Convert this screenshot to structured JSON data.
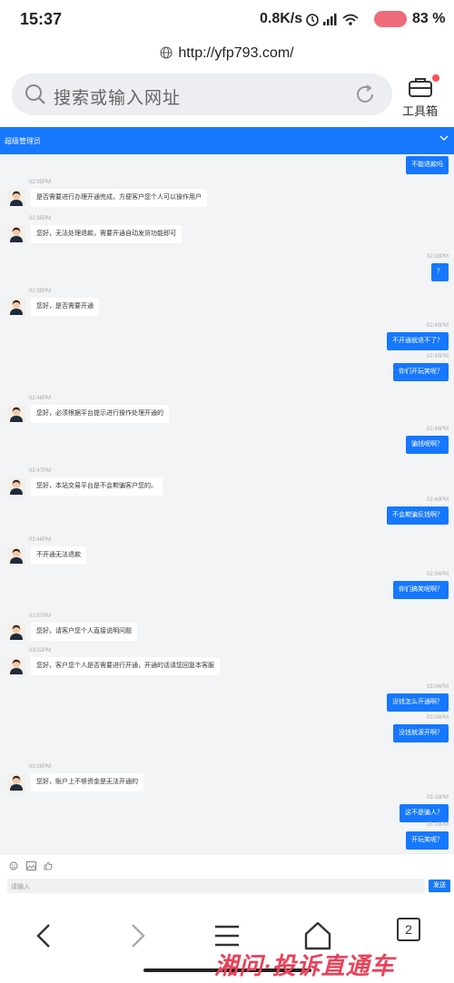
{
  "status_bar": {
    "time": "15:37",
    "speed": "0.8K/s",
    "battery": "83",
    "battery_unit": "%"
  },
  "browser": {
    "url": "http://yfp793.com/",
    "search_placeholder": "搜索或输入网址",
    "toolbox_label": "工具箱"
  },
  "chat": {
    "header_title": "超级管理员",
    "messages": [
      {
        "dir": "out",
        "text": "不能退款吗",
        "time": ""
      },
      {
        "dir": "in",
        "text": "是否需要进行办理开通完成，方便客户您个人可以操作用户",
        "time": "02:35PM"
      },
      {
        "dir": "in",
        "text": "您好，无法处理退款，需要开通自动发货功能即可",
        "time": "02:35PM"
      },
      {
        "dir": "out",
        "text": "？",
        "time": "02:38PM"
      },
      {
        "dir": "in",
        "text": "您好，是否需要开通",
        "time": "02:38PM"
      },
      {
        "dir": "out",
        "text": "不开通就退不了？",
        "time": "02:45PM"
      },
      {
        "dir": "out",
        "text": "你们开玩笑呢？",
        "time": "02:45PM"
      },
      {
        "dir": "in",
        "text": "您好，必须根据平台提示进行操作处理开通的",
        "time": "02:46PM"
      },
      {
        "dir": "out",
        "text": "骗钱呢啊？",
        "time": "02:46PM"
      },
      {
        "dir": "in",
        "text": "您好，本站交易平台是不会欺骗客户您的。",
        "time": "02:47PM"
      },
      {
        "dir": "out",
        "text": "不会欺骗反钱啊？",
        "time": "02:48PM"
      },
      {
        "dir": "in",
        "text": "不开通无法退款",
        "time": "02:48PM"
      },
      {
        "dir": "out",
        "text": "你们搞笑呢啊？",
        "time": "02:54PM"
      },
      {
        "dir": "in",
        "text": "您好，请客户您个人直接说明问题",
        "time": "02:57PM"
      },
      {
        "dir": "in",
        "text": "您好，客户您个人是否需要进行开通，开通的话请您回复本客服",
        "time": "03:02PM"
      },
      {
        "dir": "out",
        "text": "没钱怎么开通啊？",
        "time": "03:04PM"
      },
      {
        "dir": "out",
        "text": "没钱就滚开啊？",
        "time": "03:04PM"
      },
      {
        "dir": "in",
        "text": "您好，账户上不够资金是无法开通的",
        "time": "03:06PM"
      },
      {
        "dir": "out",
        "text": "这不是骗人？",
        "time": "03:18PM"
      },
      {
        "dir": "out",
        "text": "开玩笑呢？",
        "time": "03:19PM"
      }
    ],
    "input_placeholder": "请输入",
    "send_label": "发送"
  },
  "nav": {
    "tab_count": "2"
  },
  "watermark": "湘问·投诉直通车",
  "colors": {
    "accent": "#1677ff",
    "chat_bg": "#f3f4f6",
    "watermark": "#e8425a"
  }
}
